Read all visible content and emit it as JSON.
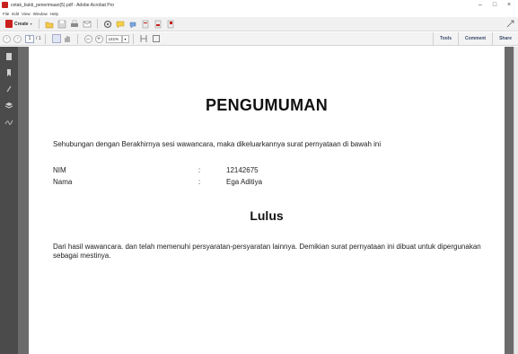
{
  "window": {
    "title": "cetak_bukti_penerimaan(5).pdf - Adobe Acrobat Pro",
    "controls": {
      "minimize": "–",
      "maximize": "□",
      "close": "×"
    }
  },
  "menu": [
    "File",
    "Edit",
    "View",
    "Window",
    "Help"
  ],
  "toolbar": {
    "create_label": "Create",
    "create_caret": "▾",
    "icons": [
      "open-icon",
      "save-icon",
      "print-icon",
      "email-icon",
      "settings-icon",
      "comment-icon",
      "highlight-icon",
      "combine-icon",
      "export-icon",
      "share-icon"
    ]
  },
  "nav": {
    "prev": "‹",
    "next": "›",
    "page_current": "1",
    "page_total": "/ 1",
    "zoom_minus": "–",
    "zoom_plus": "+",
    "zoom_value": "141%",
    "zoom_caret": "▾"
  },
  "panel_tabs": {
    "tools": "Tools",
    "comment": "Comment",
    "share": "Share"
  },
  "document": {
    "title": "PENGUMUMAN",
    "intro": "Sehubungan dengan Berakhirnya sesi wawancara, maka dikeluarkannya surat pernyataan di bawah ini",
    "fields": [
      {
        "label": "NIM",
        "colon": ":",
        "value": "12142675"
      },
      {
        "label": "Nama",
        "colon": ":",
        "value": "Ega Aditiya"
      }
    ],
    "status": "Lulus",
    "conclusion": "Dari hasil wawancara. dan telah memenuhi persyaratan-persyaratan lainnya. Demikian surat pernyataan ini dibuat untuk dipergunakan sebagai mestinya."
  },
  "colors": {
    "accent_red": "#c8201d",
    "sidebar": "#4b4b4b",
    "doc_background": "#6b6b6b"
  }
}
